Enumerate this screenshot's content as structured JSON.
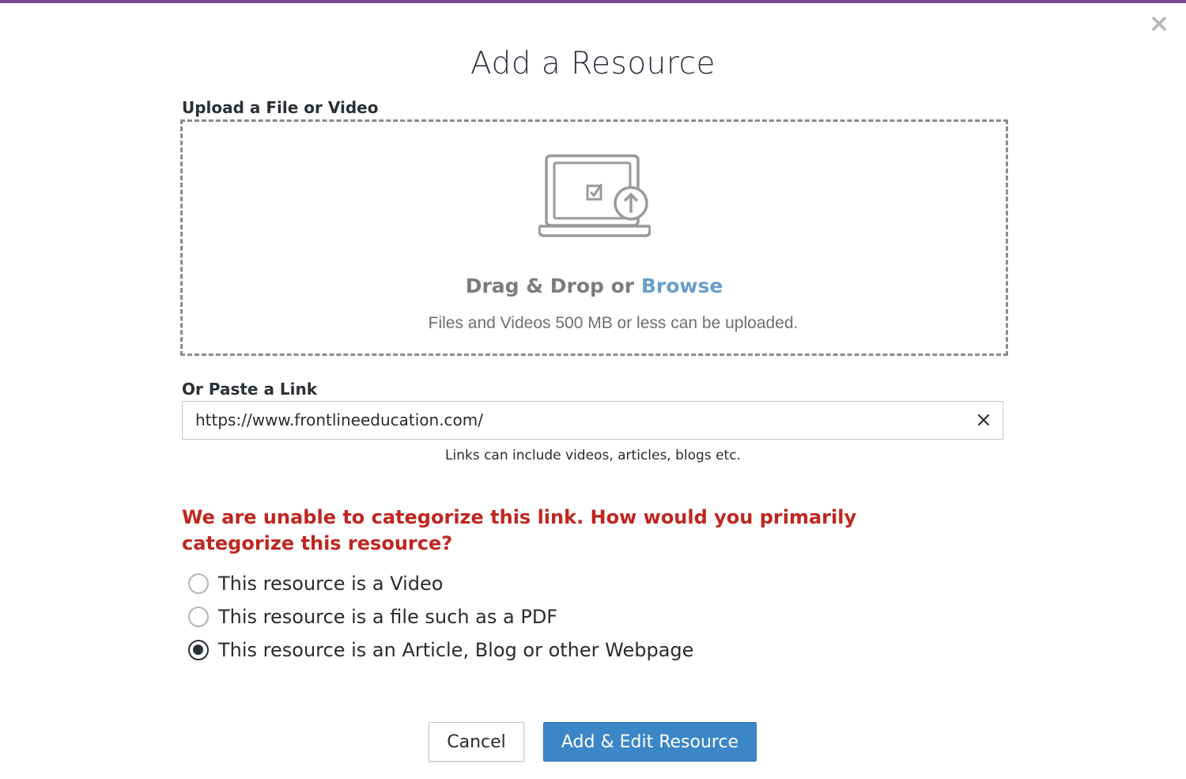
{
  "dialog": {
    "title": "Add a Resource",
    "close_icon": "close-icon"
  },
  "upload": {
    "label": "Upload a File or Video",
    "icon": "laptop-upload-icon",
    "drag_text": "Drag & Drop or ",
    "browse_text": "Browse",
    "size_hint": "Files and Videos 500 MB or less can be uploaded."
  },
  "link": {
    "label": "Or Paste a Link",
    "value": "https://www.frontlineeducation.com/",
    "clear_icon": "clear-icon",
    "hint": "Links can include videos, articles, blogs etc."
  },
  "categorize": {
    "warning": "We are unable to categorize this link. How would you primarily categorize this resource?",
    "options": [
      {
        "label": "This resource is a Video",
        "selected": false
      },
      {
        "label": "This resource is a file such as a PDF",
        "selected": false
      },
      {
        "label": "This resource is an Article, Blog or other Webpage",
        "selected": true
      }
    ]
  },
  "actions": {
    "cancel_label": "Cancel",
    "submit_label": "Add & Edit Resource"
  },
  "colors": {
    "top_bar": "#7a4a8a",
    "warning": "#c0261f",
    "primary_button": "#3b86c6",
    "browse_link": "#6a9ec8"
  }
}
